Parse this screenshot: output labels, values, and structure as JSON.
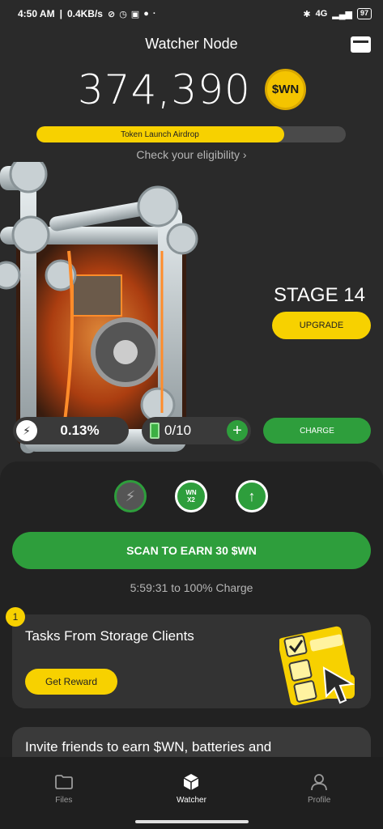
{
  "status_bar": {
    "time": "4:50 AM",
    "speed": "0.4KB/s",
    "network": "4G",
    "battery": "97"
  },
  "header": {
    "title": "Watcher Node"
  },
  "balance": {
    "amount": "374,390",
    "coin_label": "$WN"
  },
  "airdrop": {
    "label": "Token Launch Airdrop",
    "progress_fraction": 0.8,
    "eligibility_link": "Check your eligibility ›"
  },
  "stage": {
    "label": "STAGE 14",
    "upgrade_label": "UPGRADE"
  },
  "stats": {
    "percent": "0.13%",
    "batteries": "0/10",
    "charge_label": "CHARGE"
  },
  "boosts": {
    "multiplier_label_top": "WN",
    "multiplier_label_bottom": "X2"
  },
  "scan": {
    "label": "SCAN TO EARN 30 $WN",
    "countdown": "5:59:31 to 100% Charge"
  },
  "task": {
    "badge": "1",
    "title": "Tasks From Storage Clients",
    "button": "Get Reward"
  },
  "invite": {
    "text": "Invite friends to earn $WN, batteries and"
  },
  "nav": {
    "items": [
      {
        "label": "Files",
        "icon": "folder-icon"
      },
      {
        "label": "Watcher",
        "icon": "cube-icon"
      },
      {
        "label": "Profile",
        "icon": "user-icon"
      }
    ],
    "active": "Watcher"
  },
  "colors": {
    "accent_green": "#2e9e3c",
    "accent_yellow": "#f7d100",
    "background": "#2a2a2a"
  }
}
